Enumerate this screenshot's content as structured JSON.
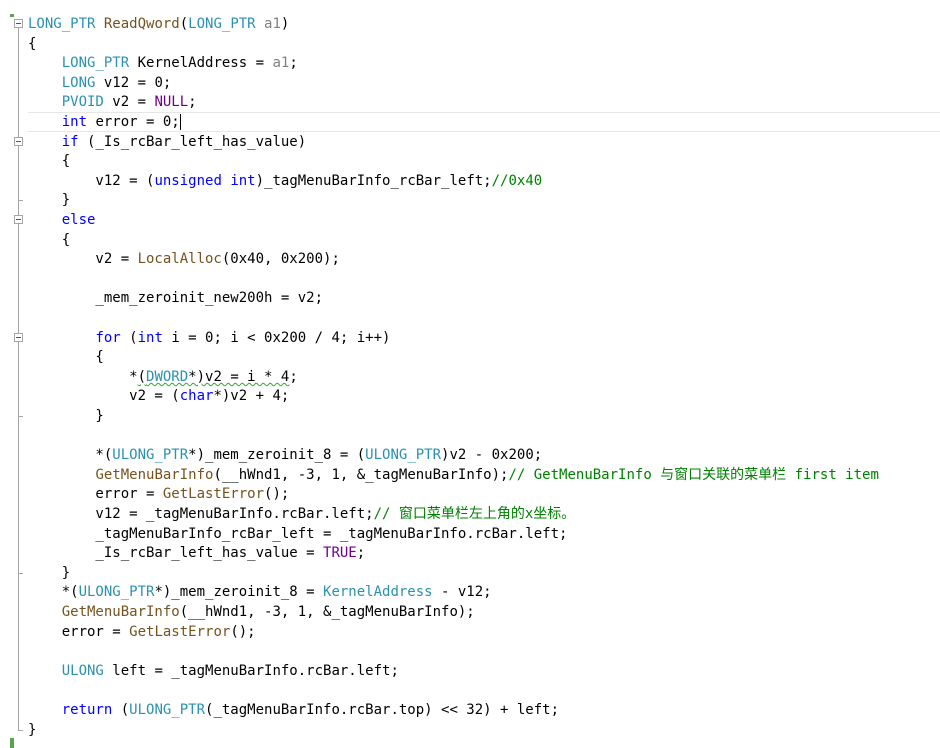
{
  "lines": [
    "LONG_PTR ReadQword(LONG_PTR a1)",
    "{",
    "    LONG_PTR KernelAddress = a1;",
    "    LONG v12 = 0;",
    "    PVOID v2 = NULL;",
    "    int error = 0;",
    "    if (_Is_rcBar_left_has_value)",
    "    {",
    "        v12 = (unsigned int)_tagMenuBarInfo_rcBar_left;//0x40",
    "    }",
    "    else",
    "    {",
    "        v2 = LocalAlloc(0x40, 0x200);",
    "",
    "        _mem_zeroinit_new200h = v2;",
    "",
    "        for (int i = 0; i < 0x200 / 4; i++)",
    "        {",
    "            *(DWORD*)v2 = i * 4;",
    "            v2 = (char*)v2 + 4;",
    "        }",
    "",
    "        *(ULONG_PTR*)_mem_zeroinit_8 = (ULONG_PTR)v2 - 0x200;",
    "        GetMenuBarInfo(__hWnd1, -3, 1, &_tagMenuBarInfo);// GetMenuBarInfo 与窗口关联的菜单栏 first item",
    "        error = GetLastError();",
    "        v12 = _tagMenuBarInfo.rcBar.left;// 窗口菜单栏左上角的x坐标。",
    "        _tagMenuBarInfo_rcBar_left = _tagMenuBarInfo.rcBar.left;",
    "        _Is_rcBar_left_has_value = TRUE;",
    "    }",
    "    *(ULONG_PTR*)_mem_zeroinit_8 = KernelAddress - v12;",
    "    GetMenuBarInfo(__hWnd1, -3, 1, &_tagMenuBarInfo);",
    "    error = GetLastError();",
    "",
    "    ULONG left = _tagMenuBarInfo.rcBar.left;",
    "",
    "    return (ULONG_PTR(_tagMenuBarInfo.rcBar.top) << 32) + left;",
    "}"
  ],
  "spans": [
    [
      [
        "ty",
        "LONG_PTR"
      ],
      [
        "t",
        " "
      ],
      [
        "fn",
        "ReadQword"
      ],
      [
        "t",
        "("
      ],
      [
        "ty",
        "LONG_PTR"
      ],
      [
        "t",
        " "
      ],
      [
        "pa",
        "a1"
      ],
      [
        "t",
        ")"
      ]
    ],
    [
      [
        "t",
        "{"
      ]
    ],
    [
      [
        "t",
        "    "
      ],
      [
        "ty",
        "LONG_PTR"
      ],
      [
        "t",
        " KernelAddress = "
      ],
      [
        "pa",
        "a1"
      ],
      [
        "t",
        ";"
      ]
    ],
    [
      [
        "t",
        "    "
      ],
      [
        "ty",
        "LONG"
      ],
      [
        "t",
        " v12 = 0;"
      ]
    ],
    [
      [
        "t",
        "    "
      ],
      [
        "ty",
        "PVOID"
      ],
      [
        "t",
        " v2 = "
      ],
      [
        "mc",
        "NULL"
      ],
      [
        "t",
        ";"
      ]
    ],
    [
      [
        "t",
        "    "
      ],
      [
        "kw",
        "int"
      ],
      [
        "t",
        " error = 0;"
      ]
    ],
    [
      [
        "t",
        "    "
      ],
      [
        "kw",
        "if"
      ],
      [
        "t",
        " (_Is_rcBar_left_has_value)"
      ]
    ],
    [
      [
        "t",
        "    {"
      ]
    ],
    [
      [
        "t",
        "        v12 = ("
      ],
      [
        "kw",
        "unsigned"
      ],
      [
        "t",
        " "
      ],
      [
        "kw",
        "int"
      ],
      [
        "t",
        ")_tagMenuBarInfo_rcBar_left;"
      ],
      [
        "cm",
        "//0x40"
      ]
    ],
    [
      [
        "t",
        "    }"
      ]
    ],
    [
      [
        "t",
        "    "
      ],
      [
        "kw",
        "else"
      ]
    ],
    [
      [
        "t",
        "    {"
      ]
    ],
    [
      [
        "t",
        "        v2 = "
      ],
      [
        "fn",
        "LocalAlloc"
      ],
      [
        "t",
        "(0x40, 0x200);"
      ]
    ],
    [],
    [
      [
        "t",
        "        _mem_zeroinit_new200h = v2;"
      ]
    ],
    [],
    [
      [
        "t",
        "        "
      ],
      [
        "kw",
        "for"
      ],
      [
        "t",
        " ("
      ],
      [
        "kw",
        "int"
      ],
      [
        "t",
        " i = 0; i < 0x200 / 4; i++)"
      ]
    ],
    [
      [
        "t",
        "        {"
      ]
    ],
    [
      [
        "t",
        "            *"
      ],
      [
        "sq",
        "("
      ],
      [
        "sqty",
        "DWORD"
      ],
      [
        "sq",
        "*)v2 = i * 4"
      ],
      [
        "t",
        ";"
      ]
    ],
    [
      [
        "t",
        "            v2 = ("
      ],
      [
        "kw",
        "char"
      ],
      [
        "t",
        "*)v2 + 4;"
      ]
    ],
    [
      [
        "t",
        "        }"
      ]
    ],
    [],
    [
      [
        "t",
        "        *("
      ],
      [
        "ty",
        "ULONG_PTR"
      ],
      [
        "t",
        "*)_mem_zeroinit_8 = ("
      ],
      [
        "ty",
        "ULONG_PTR"
      ],
      [
        "t",
        ")v2 - 0x200;"
      ]
    ],
    [
      [
        "t",
        "        "
      ],
      [
        "fn",
        "GetMenuBarInfo"
      ],
      [
        "t",
        "(__hWnd1, -3, 1, &_tagMenuBarInfo);"
      ],
      [
        "cm",
        "// GetMenuBarInfo 与窗口关联的菜单栏 first item"
      ]
    ],
    [
      [
        "t",
        "        error = "
      ],
      [
        "fn",
        "GetLastError"
      ],
      [
        "t",
        "();"
      ]
    ],
    [
      [
        "t",
        "        v12 = _tagMenuBarInfo.rcBar.left;"
      ],
      [
        "cm",
        "// 窗口菜单栏左上角的x坐标。"
      ]
    ],
    [
      [
        "t",
        "        _tagMenuBarInfo_rcBar_left = _tagMenuBarInfo.rcBar.left;"
      ]
    ],
    [
      [
        "t",
        "        _Is_rcBar_left_has_value = "
      ],
      [
        "mc",
        "TRUE"
      ],
      [
        "t",
        ";"
      ]
    ],
    [
      [
        "t",
        "    }"
      ]
    ],
    [
      [
        "t",
        "    *("
      ],
      [
        "ty",
        "ULONG_PTR"
      ],
      [
        "t",
        "*)_mem_zeroinit_8 = "
      ],
      [
        "ty",
        "KernelAddress"
      ],
      [
        "t",
        " - v12;"
      ]
    ],
    [
      [
        "t",
        "    "
      ],
      [
        "fn",
        "GetMenuBarInfo"
      ],
      [
        "t",
        "(__hWnd1, -3, 1, &_tagMenuBarInfo);"
      ]
    ],
    [
      [
        "t",
        "    error = "
      ],
      [
        "fn",
        "GetLastError"
      ],
      [
        "t",
        "();"
      ]
    ],
    [],
    [
      [
        "t",
        "    "
      ],
      [
        "ty",
        "ULONG"
      ],
      [
        "t",
        " left = _tagMenuBarInfo.rcBar.left;"
      ]
    ],
    [],
    [
      [
        "t",
        "    "
      ],
      [
        "kw",
        "return"
      ],
      [
        "t",
        " ("
      ],
      [
        "ty",
        "ULONG_PTR"
      ],
      [
        "t",
        "(_tagMenuBarInfo.rcBar.top) << 32) + left;"
      ]
    ],
    [
      [
        "t",
        "}"
      ]
    ]
  ],
  "current_line": 5,
  "fold_regions": [
    {
      "start": 0,
      "end": 36
    },
    {
      "start": 6,
      "end": 9
    },
    {
      "start": 10,
      "end": 28
    },
    {
      "start": 16,
      "end": 20
    }
  ],
  "colors": {
    "keyword": "#0000ff",
    "type": "#2b91af",
    "function": "#74531f",
    "parameter": "#808080",
    "comment": "#008000",
    "macro": "#6f008a",
    "change_bar": "#57a64a"
  }
}
